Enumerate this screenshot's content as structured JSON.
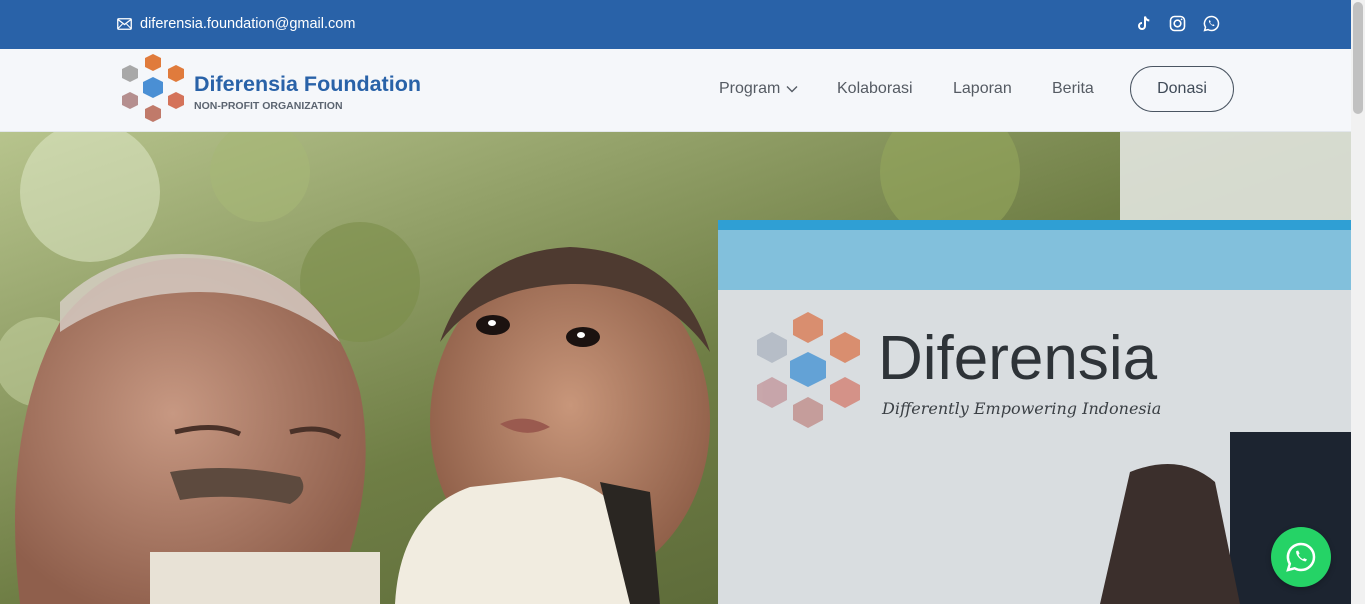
{
  "topbar": {
    "email": "diferensia.foundation@gmail.com",
    "socials": [
      "tiktok-icon",
      "instagram-icon",
      "whatsapp-icon"
    ]
  },
  "brand": {
    "title": "Diferensia Foundation",
    "subtitle": "NON-PROFIT ORGANIZATION"
  },
  "nav": {
    "items": [
      "Program",
      "Kolaborasi",
      "Laporan",
      "Berita"
    ],
    "cta": "Donasi"
  },
  "hero": {
    "sign_title": "Diferensia",
    "sign_tagline": "Differently Empowering Indonesia"
  },
  "colors": {
    "primary": "#2962a8",
    "whatsapp": "#25d366",
    "hex_orange": "#e07b3c",
    "hex_blue": "#4a8fd4",
    "hex_gray": "#a8a8a8",
    "hex_rose": "#b58f8f"
  }
}
